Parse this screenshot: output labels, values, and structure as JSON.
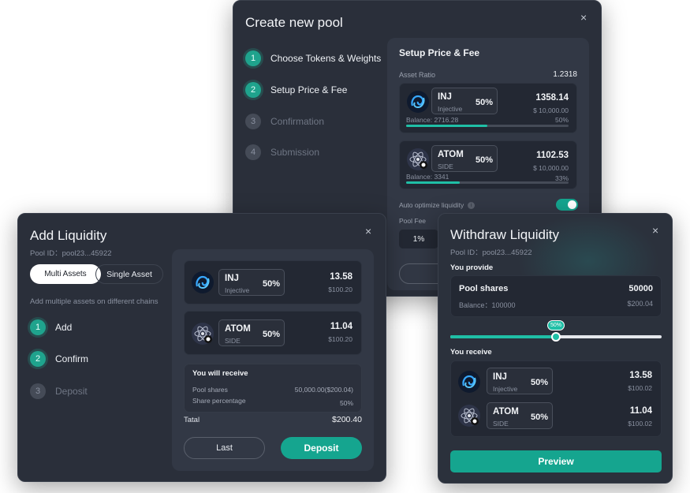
{
  "create_pool": {
    "title": "Create new pool",
    "steps": [
      {
        "num": "1",
        "label": "Choose Tokens & Weights"
      },
      {
        "num": "2",
        "label": "Setup Price & Fee"
      },
      {
        "num": "3",
        "label": "Confirmation"
      },
      {
        "num": "4",
        "label": "Submission"
      }
    ],
    "section_title": "Setup Price & Fee",
    "asset_ratio_label": "Asset Ratio",
    "asset_ratio_value": "1.2318",
    "tokens": [
      {
        "name": "INJ",
        "sub": "Injective",
        "pct": "50%",
        "amount": "1358.14",
        "usd": "$ 10,000.00",
        "balance": "Balance: 2716.28",
        "bar_pct_label": "50%",
        "fill": 0.5
      },
      {
        "name": "ATOM",
        "sub": "SIDE",
        "pct": "50%",
        "amount": "1102.53",
        "usd": "$ 10,000.00",
        "balance": "Balance: 3341",
        "bar_pct_label": "33%",
        "fill": 0.33
      }
    ],
    "auto_optimize_label": "Auto optimize liquidity",
    "pool_fee_label": "Pool Fee",
    "pool_fee_value": "1%",
    "last_button_partial": "la"
  },
  "add_liquidity": {
    "title": "Add Liquidity",
    "pool_id": "Pool ID：pool23...45922",
    "tab_multi": "Multi Assets",
    "tab_single": "Single Asset",
    "hint": "Add multiple assets on different chains",
    "steps": [
      {
        "num": "1",
        "label": "Add"
      },
      {
        "num": "2",
        "label": "Confirm"
      },
      {
        "num": "3",
        "label": "Deposit"
      }
    ],
    "tokens": [
      {
        "name": "INJ",
        "sub": "Injective",
        "pct": "50%",
        "amount": "13.58",
        "usd": "$100.20"
      },
      {
        "name": "ATOM",
        "sub": "SIDE",
        "pct": "50%",
        "amount": "11.04",
        "usd": "$100.20"
      }
    ],
    "receive_title": "You will receive",
    "pool_shares_label": "Pool shares",
    "pool_shares_value": "50,000.00($200.04)",
    "share_pct_label": "Share percentage",
    "share_pct_value": "50%",
    "total_label": "Tatal",
    "total_value": "$200.40",
    "last_button": "Last",
    "deposit_button": "Deposit"
  },
  "withdraw": {
    "title": "Withdraw Liquidity",
    "pool_id": "Pool ID：pool23...45922",
    "provide_label": "You provide",
    "pool_shares_label": "Pool shares",
    "pool_shares_value": "50000",
    "balance_label": "Balance：100000",
    "balance_usd": "$200.04",
    "slider_label": "50%",
    "slider_value": 0.5,
    "receive_label": "You receive",
    "tokens": [
      {
        "name": "INJ",
        "sub": "Injective",
        "pct": "50%",
        "amount": "13.58",
        "usd": "$100.02"
      },
      {
        "name": "ATOM",
        "sub": "SIDE",
        "pct": "50%",
        "amount": "11.04",
        "usd": "$100.02"
      }
    ],
    "preview_button": "Preview"
  },
  "close_symbol": "×",
  "colors": {
    "accent": "#15a58f",
    "panel": "#2a2f3a",
    "card": "#232833"
  }
}
